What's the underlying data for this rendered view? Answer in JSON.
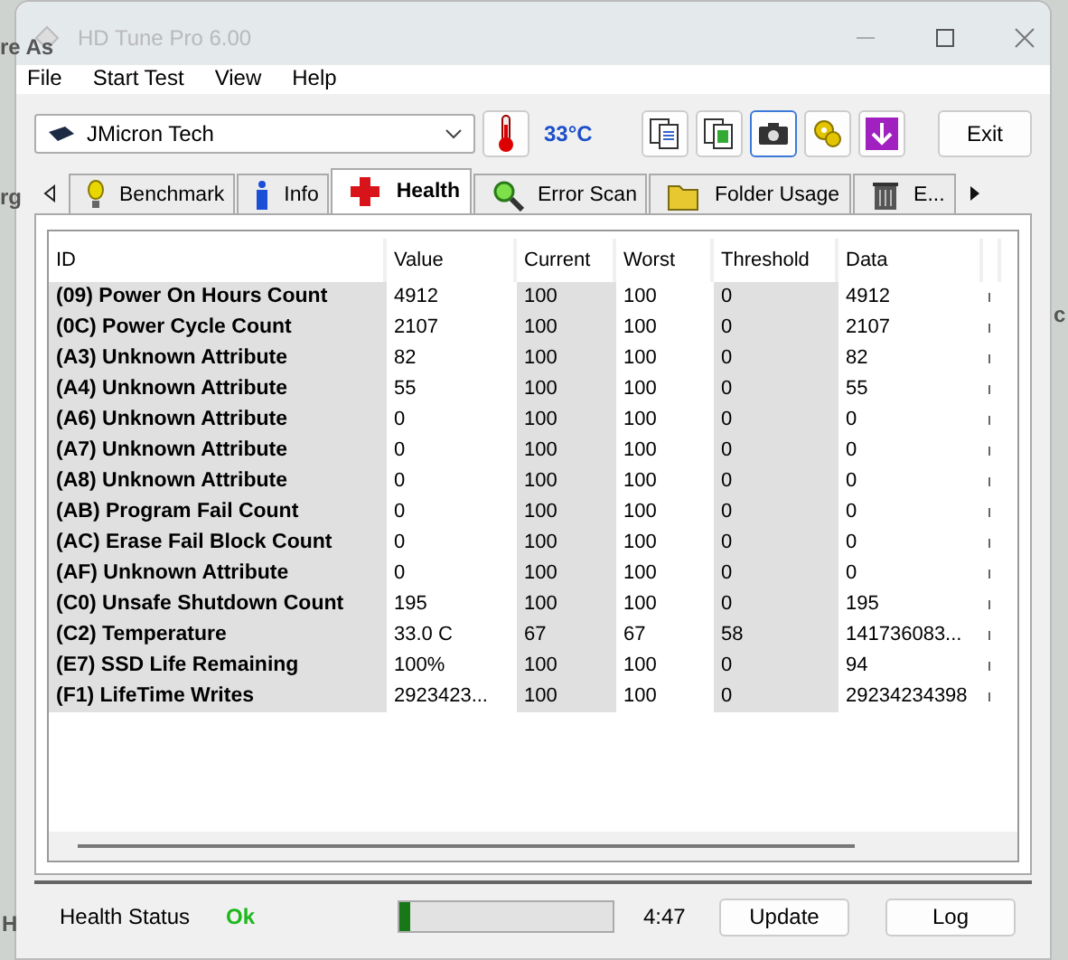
{
  "background_texts": [
    {
      "text": "re As"
    },
    {
      "text": "rg"
    },
    {
      "text": "c"
    },
    {
      "text": "H"
    }
  ],
  "window": {
    "title": "HD Tune Pro 6.00"
  },
  "menu": [
    "File",
    "Start Test",
    "View",
    "Help"
  ],
  "toolbar": {
    "drive": "JMicron Tech",
    "temperature": "33°C",
    "exit": "Exit"
  },
  "tabs": [
    {
      "label": "Benchmark",
      "selected": false
    },
    {
      "label": "Info",
      "selected": false
    },
    {
      "label": "Health",
      "selected": true
    },
    {
      "label": "Error Scan",
      "selected": false
    },
    {
      "label": "Folder Usage",
      "selected": false
    },
    {
      "label": "E...",
      "selected": false
    }
  ],
  "table": {
    "columns": [
      "ID",
      "Value",
      "Current",
      "Worst",
      "Threshold",
      "Data"
    ],
    "rows": [
      [
        "(09) Power On Hours Count",
        "4912",
        "100",
        "100",
        "0",
        "4912"
      ],
      [
        "(0C) Power Cycle Count",
        "2107",
        "100",
        "100",
        "0",
        "2107"
      ],
      [
        "(A3) Unknown Attribute",
        "82",
        "100",
        "100",
        "0",
        "82"
      ],
      [
        "(A4) Unknown Attribute",
        "55",
        "100",
        "100",
        "0",
        "55"
      ],
      [
        "(A6) Unknown Attribute",
        "0",
        "100",
        "100",
        "0",
        "0"
      ],
      [
        "(A7) Unknown Attribute",
        "0",
        "100",
        "100",
        "0",
        "0"
      ],
      [
        "(A8) Unknown Attribute",
        "0",
        "100",
        "100",
        "0",
        "0"
      ],
      [
        "(AB) Program Fail Count",
        "0",
        "100",
        "100",
        "0",
        "0"
      ],
      [
        "(AC) Erase Fail Block Count",
        "0",
        "100",
        "100",
        "0",
        "0"
      ],
      [
        "(AF) Unknown Attribute",
        "0",
        "100",
        "100",
        "0",
        "0"
      ],
      [
        "(C0) Unsafe Shutdown Count",
        "195",
        "100",
        "100",
        "0",
        "195"
      ],
      [
        "(C2) Temperature",
        "33.0 C",
        "67",
        "67",
        "58",
        "141736083..."
      ],
      [
        "(E7) SSD Life Remaining",
        "100%",
        "100",
        "100",
        "0",
        "94"
      ],
      [
        "(F1) LifeTime Writes",
        "2923423...",
        "100",
        "100",
        "0",
        "29234234398"
      ]
    ]
  },
  "status": {
    "label": "Health Status",
    "value": "Ok",
    "level": 0.05,
    "time": "4:47",
    "buttons": [
      "Update",
      "Log"
    ]
  }
}
